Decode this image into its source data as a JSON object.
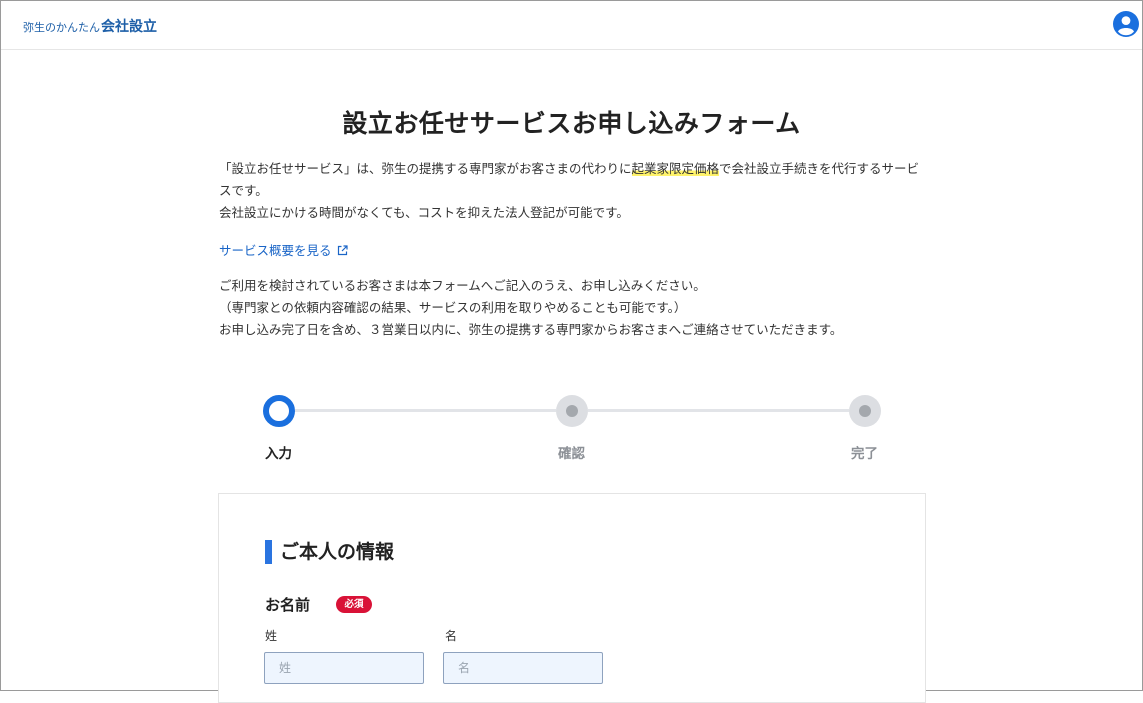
{
  "header": {
    "brand_sub": "弥生のかんたん",
    "brand_main": "会社設立",
    "user_icon": "user-circle-icon"
  },
  "page": {
    "title": "設立お任せサービスお申し込みフォーム",
    "intro_1": "「設立お任せサービス」は、弥生の提携する専門家がお客さまの代わりに",
    "intro_highlight": "起業家限定価格",
    "intro_2": "で会社設立手続きを代行するサービスです。",
    "intro_3": "会社設立にかける時間がなくても、コストを抑えた法人登記が可能です。",
    "overview_link": "サービス概要を見る",
    "note_1": "ご利用を検討されているお客さまは本フォームへご記入のうえ、お申し込みください。",
    "note_2": "（専門家との依頼内容確認の結果、サービスの利用を取りやめることも可能です。）",
    "note_3": "お申し込み完了日を含め、３営業日以内に、弥生の提携する専門家からお客さまへご連絡させていただきます。"
  },
  "stepper": {
    "steps": [
      {
        "label": "入力",
        "state": "active"
      },
      {
        "label": "確認",
        "state": "inactive"
      },
      {
        "label": "完了",
        "state": "inactive"
      }
    ]
  },
  "form": {
    "section_title": "ご本人の情報",
    "name_label": "お名前",
    "required_badge": "必須",
    "last_name_label": "姓",
    "last_name_placeholder": "姓",
    "last_name_value": "",
    "first_name_label": "名",
    "first_name_placeholder": "名",
    "first_name_value": ""
  },
  "colors": {
    "brand": "#1d5fa8",
    "accent": "#1a6fde",
    "required": "#d91237",
    "highlight": "#fff36b",
    "link": "#1a65c7"
  }
}
